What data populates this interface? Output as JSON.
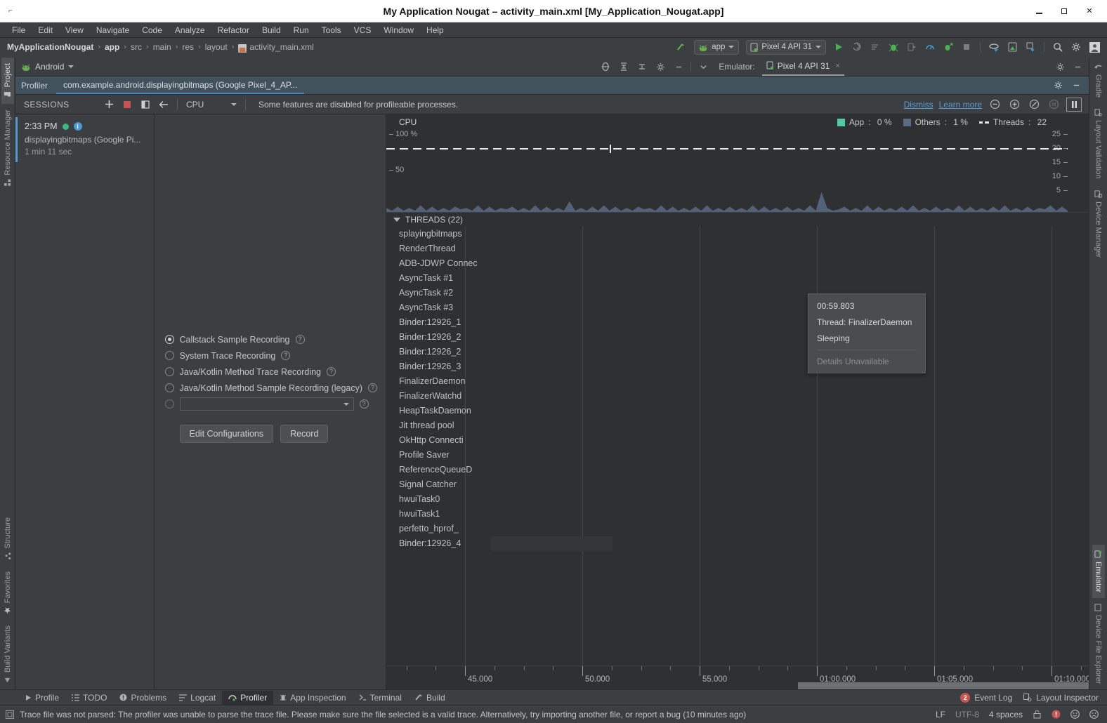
{
  "window": {
    "title": "My Application Nougat – activity_main.xml [My_Application_Nougat.app]",
    "minimize": "–",
    "maximize": "□",
    "close": "×"
  },
  "menu": [
    "File",
    "Edit",
    "View",
    "Navigate",
    "Code",
    "Analyze",
    "Refactor",
    "Build",
    "Run",
    "Tools",
    "VCS",
    "Window",
    "Help"
  ],
  "breadcrumb": {
    "items": [
      "MyApplicationNougat",
      "app",
      "src",
      "main",
      "res",
      "layout"
    ],
    "file": "activity_main.xml",
    "separator": "›"
  },
  "toolbar": {
    "module_selector": "app",
    "device_selector": "Pixel 4 API 31",
    "icons": [
      "run-icon",
      "apply-changes-icon",
      "apply-code-changes-icon",
      "debug-icon",
      "attach-debugger-icon",
      "profile-icon",
      "run-with-coverage-icon",
      "stop-icon",
      "sync-gradle-icon",
      "avd-manager-icon",
      "sdk-manager-icon",
      "search-icon",
      "settings-icon",
      "account-icon"
    ]
  },
  "left_strip": [
    {
      "label": "Project",
      "icon": "project-icon",
      "active": true
    },
    {
      "label": "Resource Manager",
      "icon": "resource-manager-icon",
      "active": false
    },
    {
      "label": "Structure",
      "icon": "structure-icon",
      "active": false
    },
    {
      "label": "Favorites",
      "icon": "star-icon",
      "active": false
    },
    {
      "label": "Build Variants",
      "icon": "build-variants-icon",
      "active": false
    }
  ],
  "right_strip": [
    {
      "label": "Gradle",
      "icon": "gradle-icon",
      "active": false
    },
    {
      "label": "Layout Validation",
      "icon": "layout-validation-icon",
      "active": false
    },
    {
      "label": "Device Manager",
      "icon": "device-manager-icon",
      "active": false
    },
    {
      "label": "Emulator",
      "icon": "emulator-icon",
      "active": true
    },
    {
      "label": "Device File Explorer",
      "icon": "device-file-explorer-icon",
      "active": false
    }
  ],
  "pane_header": {
    "title": "Android",
    "emulator_label": "Emulator:",
    "emulator_tab": "Pixel 4 API 31",
    "emulator_close": "×"
  },
  "profiler_bar": {
    "label": "Profiler",
    "tab": "com.example.android.displayingbitmaps (Google Pixel_4_AP..."
  },
  "sessions_toolbar": {
    "title": "SESSIONS",
    "add": "+",
    "stop": "stop-icon",
    "split": "split-icon",
    "back": "←",
    "mode": "CPU",
    "message": "Some features are disabled for profileable processes.",
    "dismiss": "Dismiss",
    "learn_more": "Learn more"
  },
  "session": {
    "time": "2:33 PM",
    "name": "displayingbitmaps (Google Pi...",
    "duration": "1 min 11 sec"
  },
  "recording": {
    "options": [
      {
        "label": "Callstack Sample Recording",
        "selected": true,
        "enabled": true
      },
      {
        "label": "System Trace Recording",
        "selected": false,
        "enabled": true
      },
      {
        "label": "Java/Kotlin Method Trace Recording",
        "selected": false,
        "enabled": true
      },
      {
        "label": "Java/Kotlin Method Sample Recording (legacy)",
        "selected": false,
        "enabled": true
      }
    ],
    "custom_config_value": "",
    "edit_configurations": "Edit Configurations",
    "record": "Record"
  },
  "chart_data": {
    "type": "area",
    "title": "CPU",
    "ylabel": "",
    "ylim": [
      0,
      100
    ],
    "y_ticks_left": [
      "100 %",
      "50"
    ],
    "y_ticks_right": [
      "25",
      "20",
      "15",
      "10",
      "5"
    ],
    "right_axis_label": "Threads",
    "legend": [
      {
        "name": "App",
        "value": "0 %",
        "color": "#51c9a3"
      },
      {
        "name": "Others",
        "value": "1 %",
        "color": "#5b6b86"
      },
      {
        "name": "Threads",
        "value": "22",
        "color": "#e6e6e6",
        "style": "dashed"
      }
    ],
    "legend_position": "top-right",
    "series": [
      {
        "name": "Others CPU %",
        "color": "#5b6b86",
        "values": [
          3,
          1,
          4,
          1,
          3,
          1,
          5,
          1,
          4,
          1,
          3,
          1,
          4,
          2,
          3,
          1,
          5,
          1,
          4,
          1,
          3,
          2,
          4,
          1,
          3,
          1,
          5,
          1,
          4,
          1,
          3,
          1,
          8,
          1,
          3,
          1,
          4,
          1,
          5,
          1,
          4,
          1,
          3,
          1,
          4,
          2,
          3,
          1,
          5,
          1,
          4,
          1,
          3,
          1,
          4,
          1,
          5,
          1,
          3,
          1,
          4,
          1,
          3,
          1,
          5,
          1,
          4,
          1,
          3,
          1,
          4,
          1,
          3,
          1,
          5,
          1,
          15,
          3,
          1,
          2,
          4,
          1,
          3,
          1,
          5,
          1,
          4,
          1,
          3,
          1,
          4,
          1,
          5,
          1,
          3,
          1,
          4,
          1,
          3,
          1,
          5,
          1,
          4,
          1,
          3,
          1,
          4,
          1,
          5,
          1,
          3,
          1,
          4,
          1,
          3,
          2,
          5,
          1,
          4,
          1
        ]
      },
      {
        "name": "Threads count",
        "color": "#e6e6e6",
        "style": "dashed",
        "constant": 22
      }
    ],
    "x_axis": {
      "labels": [
        "45.000",
        "50.000",
        "55.000",
        "01:00.000",
        "01:05.000",
        "01:10.000"
      ],
      "grid": true
    }
  },
  "threads": {
    "header": "THREADS (22)",
    "items": [
      "splayingbitmaps",
      "RenderThread",
      "ADB-JDWP Connec",
      "AsyncTask #1",
      "AsyncTask #2",
      "AsyncTask #3",
      "Binder:12926_1",
      "Binder:12926_2",
      "Binder:12926_2",
      "Binder:12926_3",
      "FinalizerDaemon",
      "FinalizerWatchd",
      "HeapTaskDaemon",
      "Jit thread pool",
      "OkHttp Connecti",
      "Profile Saver",
      "ReferenceQueueD",
      "Signal Catcher",
      "hwuiTask0",
      "hwuiTask1",
      "perfetto_hprof_",
      "Binder:12926_4"
    ]
  },
  "tooltip": {
    "timestamp": "00:59.803",
    "thread": "Thread: FinalizerDaemon",
    "state": "Sleeping",
    "details": "Details Unavailable"
  },
  "bottom_tabs": [
    {
      "label": "Profile",
      "icon": "play-icon",
      "active": false
    },
    {
      "label": "TODO",
      "icon": "todo-icon",
      "active": false
    },
    {
      "label": "Problems",
      "icon": "problems-icon",
      "active": false
    },
    {
      "label": "Logcat",
      "icon": "logcat-icon",
      "active": false
    },
    {
      "label": "Profiler",
      "icon": "profiler-icon",
      "active": true
    },
    {
      "label": "App Inspection",
      "icon": "app-inspection-icon",
      "active": false
    },
    {
      "label": "Terminal",
      "icon": "terminal-icon",
      "active": false
    },
    {
      "label": "Build",
      "icon": "build-icon",
      "active": false
    }
  ],
  "bottom_right": {
    "event_log_count": "2",
    "event_log": "Event Log",
    "layout_inspector": "Layout Inspector"
  },
  "statusbar": {
    "message": "Trace file was not parsed: The profiler was unable to parse the trace file. Please make sure the file selected is a valid trace. Alternatively, try importing another file, or report a bug (10 minutes ago)",
    "line_sep": "LF",
    "encoding": "UTF-8",
    "indent": "4 spaces",
    "lock": "lock-icon",
    "error": "error-icon",
    "happy": "☺",
    "sad": "☹"
  },
  "colors": {
    "accent_blue": "#4a88c7",
    "link_blue": "#5b9bd5",
    "green": "#41b883",
    "app_teal": "#51c9a3",
    "others_blue": "#5b6b86",
    "red": "#c75450",
    "panel_bg": "#3c3f41",
    "timeline_bg": "#2e3032"
  }
}
